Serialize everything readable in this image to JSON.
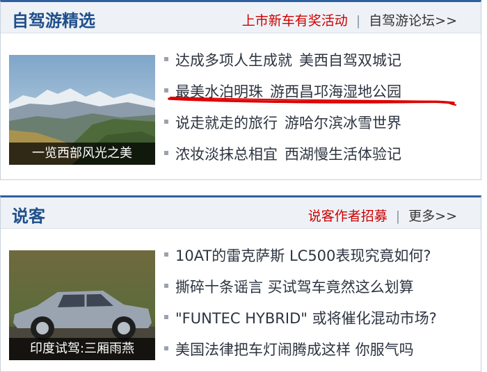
{
  "sections": {
    "selfdrive": {
      "title": "自驾游精选",
      "promo_link": "上市新车有奖活动",
      "divider": "|",
      "more_link": "自驾游论坛>>",
      "image_caption": "一览西部风光之美",
      "items": [
        {
          "a": "达成多项人生成就",
          "b": "美西自驾双城记"
        },
        {
          "a": "最美水泊明珠",
          "b": "游西昌邛海湿地公园"
        },
        {
          "a": "说走就走的旅行",
          "b": "游哈尔滨冰雪世界"
        },
        {
          "a": "浓妆淡抹总相宜",
          "b": "西湖慢生活体验记"
        }
      ]
    },
    "shuoke": {
      "title": "说客",
      "promo_link": "说客作者招募",
      "divider": "|",
      "more_link": "更多>>",
      "image_caption": "印度试驾:三厢雨燕",
      "items": [
        {
          "text": "10AT的雷克萨斯 LC500表现究竟如何?"
        },
        {
          "text": "撕碎十条谣言 买试驾车竟然这么划算"
        },
        {
          "text": "\"FUNTEC HYBRID\" 或将催化混动市场?"
        },
        {
          "text": "美国法律把车灯闹腾成这样 你服气吗"
        }
      ]
    }
  },
  "colors": {
    "header_title": "#1f4f8a",
    "promo": "#cc0000",
    "annotation": "#dd0000",
    "link": "#2d3440"
  }
}
